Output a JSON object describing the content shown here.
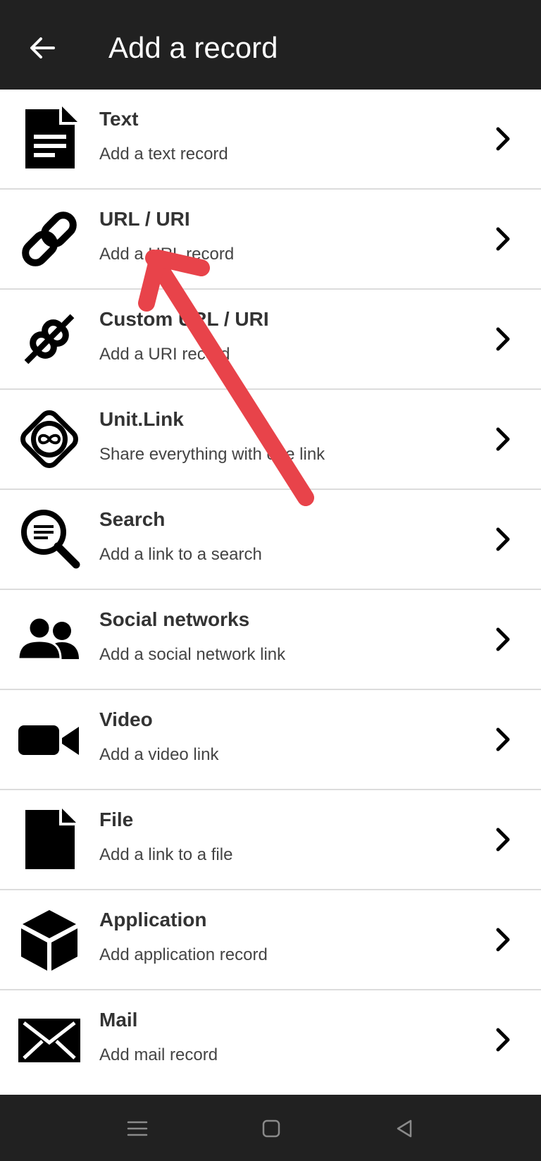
{
  "header": {
    "title": "Add a record",
    "back_icon": "arrow-left-icon"
  },
  "records": [
    {
      "icon": "text-document-icon",
      "title": "Text",
      "subtitle": "Add a text record"
    },
    {
      "icon": "link-icon",
      "title": "URL / URI",
      "subtitle": "Add a URL record"
    },
    {
      "icon": "broken-link-icon",
      "title": "Custom URL / URI",
      "subtitle": "Add a URI record"
    },
    {
      "icon": "unit-link-icon",
      "title": "Unit.Link",
      "subtitle": "Share everything with one link"
    },
    {
      "icon": "search-icon",
      "title": "Search",
      "subtitle": "Add a link to a search"
    },
    {
      "icon": "people-icon",
      "title": "Social networks",
      "subtitle": "Add a social network link"
    },
    {
      "icon": "video-camera-icon",
      "title": "Video",
      "subtitle": "Add a video link"
    },
    {
      "icon": "file-icon",
      "title": "File",
      "subtitle": "Add a link to a file"
    },
    {
      "icon": "cube-icon",
      "title": "Application",
      "subtitle": "Add application record"
    },
    {
      "icon": "envelope-icon",
      "title": "Mail",
      "subtitle": "Add mail record"
    }
  ],
  "annotation": {
    "color": "#e8434a",
    "icon": "red-arrow-annotation"
  },
  "colors": {
    "app_bar": "#212121",
    "nav_bar": "#212121",
    "divider": "#dcdcdc"
  },
  "nav": {
    "menu_icon": "menu-icon",
    "home_icon": "home-square-icon",
    "back_icon": "back-triangle-icon"
  }
}
